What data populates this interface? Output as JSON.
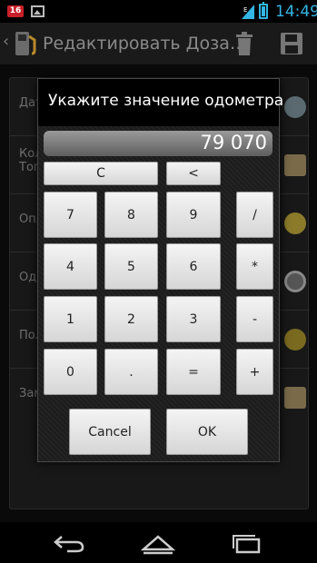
{
  "status_bar": {
    "notification_badge": "16",
    "time": "14:49",
    "accent_color": "#33b5e5",
    "icons": [
      "notification-badge-icon",
      "image-icon",
      "signal-icon",
      "battery-icon"
    ]
  },
  "action_bar": {
    "title": "Редактировать Доза…",
    "icons": [
      "back-caret-icon",
      "fuel-pump-icon",
      "trash-icon",
      "save-icon"
    ]
  },
  "background_rows": [
    {
      "label": "Дат",
      "icon": "clock-icon"
    },
    {
      "label": "Кол\nТоп",
      "icon": "stamp-icon"
    },
    {
      "label": "Опл",
      "icon": "coin-icon"
    },
    {
      "label": "Одо",
      "icon": "speedometer-icon"
    },
    {
      "label": "Пол",
      "icon": "drop-icon"
    },
    {
      "label": "Зам",
      "icon": "stamp-icon"
    }
  ],
  "dialog": {
    "title": "Укажите значение одометра",
    "display_value": "79 070",
    "keys": {
      "clear": "C",
      "backspace": "<",
      "seven": "7",
      "eight": "8",
      "nine": "9",
      "divide": "/",
      "four": "4",
      "five": "5",
      "six": "6",
      "multiply": "*",
      "one": "1",
      "two": "2",
      "three": "3",
      "minus": "-",
      "zero": "0",
      "dot": ".",
      "equals": "=",
      "plus": "+"
    },
    "cancel_label": "Cancel",
    "ok_label": "OK"
  },
  "nav_bar": {
    "icons": [
      "back-icon",
      "home-icon",
      "recents-icon"
    ]
  }
}
